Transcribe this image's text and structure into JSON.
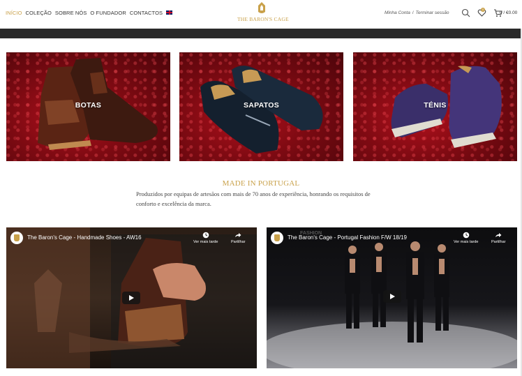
{
  "nav": {
    "items": [
      {
        "label": "INÍCIO",
        "active": true
      },
      {
        "label": "COLEÇÃO",
        "active": false
      },
      {
        "label": "SOBRE NÓS",
        "active": false
      },
      {
        "label": "O FUNDADOR",
        "active": false
      },
      {
        "label": "CONTACTOS",
        "active": false
      }
    ],
    "language_icon": "uk-flag-icon"
  },
  "brand": {
    "name": "THE BARON'S CAGE",
    "tagline": "·",
    "color": "#c9a14a"
  },
  "account": {
    "my_account": "Minha Conta",
    "separator": "/",
    "logout": "Terminar sessão"
  },
  "header_icons": {
    "search": "search-icon",
    "wishlist": "heart-icon",
    "wishlist_count": "0",
    "cart": "cart-icon",
    "cart_total": "0 / €0.00"
  },
  "categories": [
    {
      "label": "BOTAS"
    },
    {
      "label": "SAPATOS"
    },
    {
      "label": "TÉNIS"
    }
  ],
  "intro": {
    "title": "MADE IN PORTUGAL",
    "description": "Produzidos por equipas de artesãos com mais de 70 anos de experiência, honrando os requisitos de conforto e excelência da marca."
  },
  "videos": [
    {
      "title": "The Baron's Cage - Handmade Shoes - AW16",
      "watch_later": "Ver mais tarde",
      "share": "Partilhar"
    },
    {
      "title": "The Baron's Cage - Portugal Fashion F/W 18/19",
      "watch_later": "Ver mais tarde",
      "share": "Partilhar",
      "overlay_text": "FASHION"
    }
  ]
}
